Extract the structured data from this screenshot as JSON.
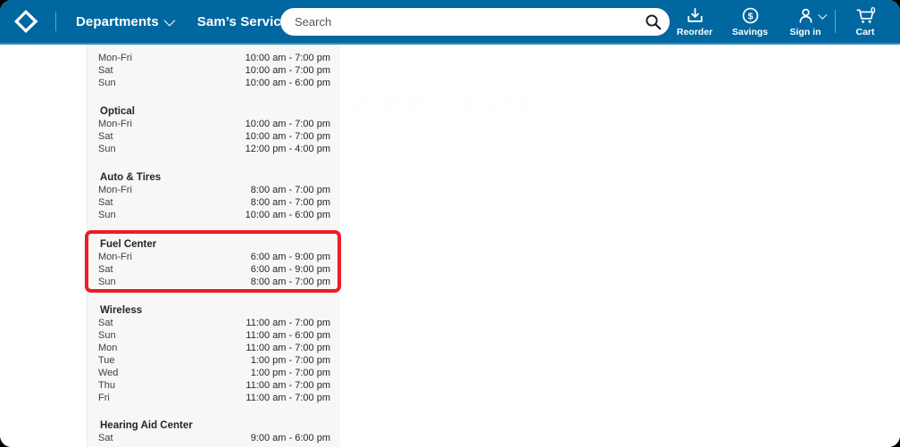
{
  "header": {
    "logo_icon": "diamond-chevron-logo",
    "nav": [
      {
        "label": "Departments",
        "icon": "chevron-down-icon"
      },
      {
        "label": "Sam’s Services",
        "icon": "chevron-down-icon"
      }
    ],
    "search": {
      "placeholder": "Search",
      "value": "",
      "icon": "search-icon"
    },
    "actions": [
      {
        "label": "Reorder",
        "icon": "reorder-download-icon"
      },
      {
        "label": "Savings",
        "icon": "savings-dollar-circle-icon"
      },
      {
        "label": "Sign in",
        "icon": "user-account-icon",
        "caret": "chevron-down-icon"
      },
      {
        "label": "Cart",
        "icon": "shopping-cart-icon",
        "badge": "0"
      }
    ],
    "colors": {
      "background": "#0067a0",
      "text": "#ffffff",
      "underline": "#3b8cb5"
    }
  },
  "annotation": {
    "target_section": "Fuel Center",
    "color": "#ee1c25",
    "shape": "rounded-rectangle-outline"
  },
  "ghost_text": "pm pm pm pm pm pm pm",
  "hours": {
    "panel_background": "#f7f7f5",
    "sections": [
      {
        "name": "",
        "title_visible": false,
        "rows": [
          {
            "day": "Mon-Fri",
            "time": "10:00 am - 7:00 pm"
          },
          {
            "day": "Sat",
            "time": "10:00 am - 7:00 pm"
          },
          {
            "day": "Sun",
            "time": "10:00 am - 6:00 pm"
          }
        ]
      },
      {
        "name": "Optical",
        "title_visible": true,
        "rows": [
          {
            "day": "Mon-Fri",
            "time": "10:00 am - 7:00 pm"
          },
          {
            "day": "Sat",
            "time": "10:00 am - 7:00 pm"
          },
          {
            "day": "Sun",
            "time": "12:00 pm - 4:00 pm"
          }
        ]
      },
      {
        "name": "Auto & Tires",
        "title_visible": true,
        "rows": [
          {
            "day": "Mon-Fri",
            "time": "8:00 am - 7:00 pm"
          },
          {
            "day": "Sat",
            "time": "8:00 am - 7:00 pm"
          },
          {
            "day": "Sun",
            "time": "10:00 am - 6:00 pm"
          }
        ]
      },
      {
        "name": "Fuel Center",
        "title_visible": true,
        "highlighted": true,
        "rows": [
          {
            "day": "Mon-Fri",
            "time": "6:00 am - 9:00 pm"
          },
          {
            "day": "Sat",
            "time": "6:00 am - 9:00 pm"
          },
          {
            "day": "Sun",
            "time": "8:00 am - 7:00 pm"
          }
        ]
      },
      {
        "name": "Wireless",
        "title_visible": true,
        "rows": [
          {
            "day": "Sat",
            "time": "11:00 am - 7:00 pm"
          },
          {
            "day": "Sun",
            "time": "11:00 am - 6:00 pm"
          },
          {
            "day": "Mon",
            "time": "11:00 am - 7:00 pm"
          },
          {
            "day": "Tue",
            "time": "1:00 pm - 7:00 pm"
          },
          {
            "day": "Wed",
            "time": "1:00 pm - 7:00 pm"
          },
          {
            "day": "Thu",
            "time": "11:00 am - 7:00 pm"
          },
          {
            "day": "Fri",
            "time": "11:00 am - 7:00 pm"
          }
        ]
      },
      {
        "name": "Hearing Aid Center",
        "title_visible": true,
        "clipped": true,
        "rows": [
          {
            "day": "Sat",
            "time": "9:00 am - 6:00 pm"
          }
        ]
      }
    ]
  }
}
